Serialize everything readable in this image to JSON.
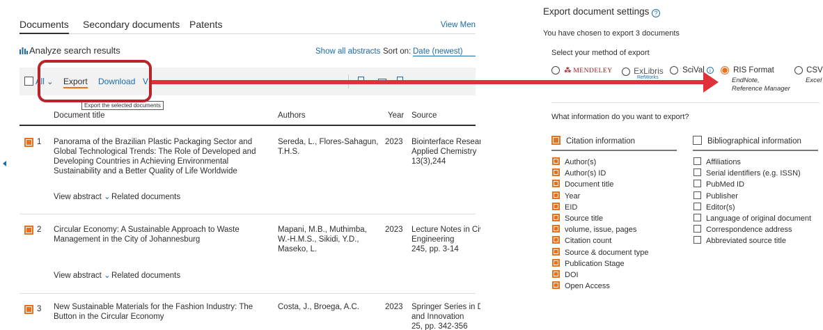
{
  "tabs": [
    "Documents",
    "Secondary documents",
    "Patents"
  ],
  "view_menu_label": "View Men",
  "analyze_label": "Analyze search results",
  "show_abstracts_label": "Show all abstracts",
  "sort_label": "Sort on:",
  "sort_value": "Date (newest)",
  "toolbar": {
    "all_label": "All",
    "export_label": "Export",
    "download_label": "Download",
    "view_partial": "V",
    "tooltip": "Export the selected documents"
  },
  "columns": {
    "title": "Document title",
    "authors": "Authors",
    "year": "Year",
    "source": "Source"
  },
  "documents": [
    {
      "num": "1",
      "title": "Panorama of the Brazilian Plastic Packaging Sector and Global Technological Trends: The Role of Developed and Developing Countries in Achieving Environmental Sustainability and a Better Quality of Life Worldwide",
      "authors": "Sereda, L., Flores-Sahagun, T.H.S.",
      "year": "2023",
      "source": [
        "Biointerface Researc",
        "Applied Chemistry",
        "13(3),244"
      ]
    },
    {
      "num": "2",
      "title": "Circular Economy: A Sustainable Approach to Waste Management in the City of Johannesburg",
      "authors": "Mapani, M.B., Muthimba, W.-H.M.S., Sikidi, Y.D., Maseko, L.",
      "year": "2023",
      "source": [
        "Lecture Notes in Civ",
        "Engineering",
        "245, pp. 3-14"
      ]
    },
    {
      "num": "3",
      "title": "New Sustainable Materials for the Fashion Industry: The Button in the Circular Economy",
      "authors": "Costa, J., Broega, A.C.",
      "year": "2023",
      "source": [
        "Springer Series in D",
        "and Innovation",
        "25, pp. 342-356"
      ]
    }
  ],
  "row_actions": {
    "view_abstract": "View abstract",
    "related": "Related documents"
  },
  "export_panel": {
    "title": "Export document settings",
    "chosen_text": "You have chosen to export 3 documents",
    "method_label": "Select your method of export",
    "methods": {
      "mendeley": "MENDELEY",
      "exlibris": "ExLibris",
      "exlibris_sub": "RefWorks",
      "scival": "SciVal",
      "ris": "RIS Format",
      "ris_sub1": "EndNote,",
      "ris_sub2": "Reference Manager",
      "csv": "CSV",
      "csv_sub": "Excel"
    },
    "info_question": "What information do you want to export?",
    "citation_header": "Citation information",
    "biblio_header": "Bibliographical information",
    "citation_items": [
      "Author(s)",
      "Author(s) ID",
      "Document title",
      "Year",
      "EID",
      "Source title",
      "volume, issue, pages",
      "Citation count",
      "Source & document type",
      "Publication Stage",
      "DOI",
      "Open Access"
    ],
    "biblio_items": [
      "Affiliations",
      "Serial identifiers (e.g. ISSN)",
      "PubMed ID",
      "Publisher",
      "Editor(s)",
      "Language of original document",
      "Correspondence address",
      "Abbreviated source title"
    ]
  }
}
